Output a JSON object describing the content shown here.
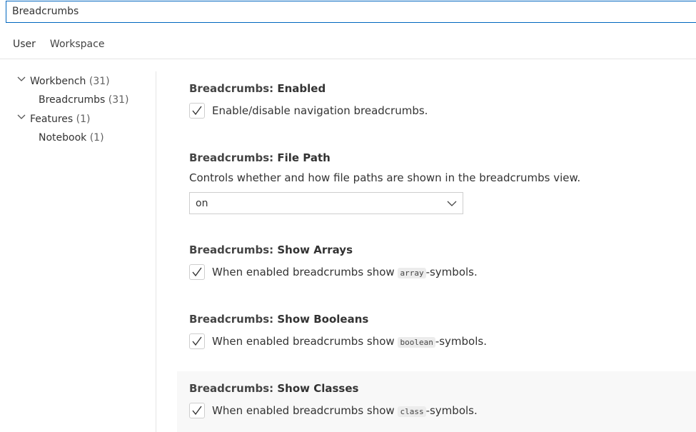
{
  "search": {
    "value": "Breadcrumbs"
  },
  "tabs": [
    {
      "label": "User",
      "active": true
    },
    {
      "label": "Workspace",
      "active": false
    }
  ],
  "toc": [
    {
      "label": "Workbench",
      "count": "(31)",
      "expanded": true
    },
    {
      "label": "Breadcrumbs",
      "count": "(31)"
    },
    {
      "label": "Features",
      "count": "(1)",
      "expanded": true
    },
    {
      "label": "Notebook",
      "count": "(1)"
    }
  ],
  "settings": {
    "enabled": {
      "category": "Breadcrumbs: ",
      "name": "Enabled",
      "description": "Enable/disable navigation breadcrumbs.",
      "checked": true
    },
    "file_path": {
      "category": "Breadcrumbs: ",
      "name": "File Path",
      "description": "Controls whether and how file paths are shown in the breadcrumbs view.",
      "value": "on"
    },
    "show_arrays": {
      "category": "Breadcrumbs: ",
      "name": "Show Arrays",
      "desc_pre": "When enabled breadcrumbs show ",
      "code": "array",
      "desc_post": "-symbols.",
      "checked": true
    },
    "show_booleans": {
      "category": "Breadcrumbs: ",
      "name": "Show Booleans",
      "desc_pre": "When enabled breadcrumbs show ",
      "code": "boolean",
      "desc_post": "-symbols.",
      "checked": true
    },
    "show_classes": {
      "category": "Breadcrumbs: ",
      "name": "Show Classes",
      "desc_pre": "When enabled breadcrumbs show ",
      "code": "class",
      "desc_post": "-symbols.",
      "checked": true
    }
  },
  "colors": {
    "accent": "#0066bf",
    "highlight_bg": "#f8f8f8"
  }
}
